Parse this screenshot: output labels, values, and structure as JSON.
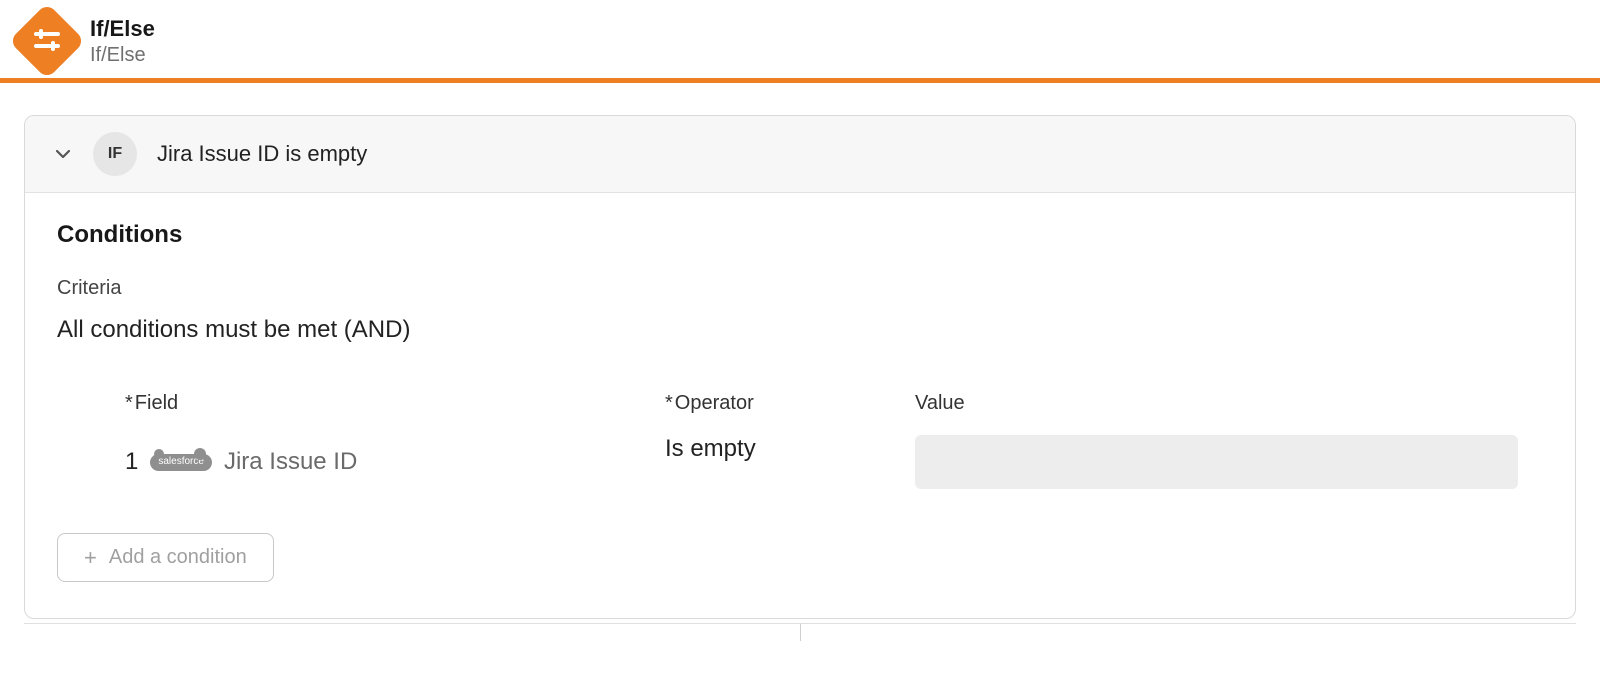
{
  "header": {
    "title": "If/Else",
    "subtitle": "If/Else"
  },
  "branch": {
    "badge": "IF",
    "title": "Jira Issue ID is empty"
  },
  "conditions": {
    "section_title": "Conditions",
    "criteria_label": "Criteria",
    "criteria_value": "All conditions must be met (AND)",
    "columns": {
      "field": "Field",
      "operator": "Operator",
      "value": "Value"
    },
    "rows": [
      {
        "num": "1",
        "source_app": "salesforce",
        "field": "Jira Issue ID",
        "operator": "Is empty",
        "value": ""
      }
    ],
    "add_button": "Add a condition"
  }
}
